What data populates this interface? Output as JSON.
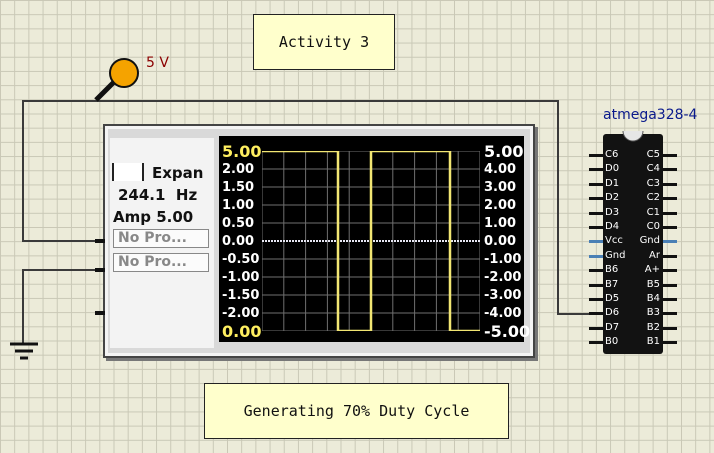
{
  "notes": {
    "activity": "Activity 3",
    "duty": "Generating 70% Duty Cycle"
  },
  "source": {
    "label": "5 V"
  },
  "oscilloscope": {
    "expand_label": "Expan",
    "frequency": "244.1  Hz",
    "amplitude": "Amp 5.00",
    "probe1": "No Pro...",
    "probe2": "No Pro...",
    "left_ticks": [
      "5.00",
      "2.00",
      "1.50",
      "1.00",
      "0.50",
      "0.00",
      "-0.50",
      "-1.00",
      "-1.50",
      "-2.00",
      "0.00"
    ],
    "right_ticks": [
      "5.00",
      "4.00",
      "3.00",
      "2.00",
      "1.00",
      "0.00",
      "-1.00",
      "-2.00",
      "-3.00",
      "-4.00",
      "-5.00"
    ],
    "trace_color": "#f2e673",
    "center_line_color": "#ffffff"
  },
  "chip": {
    "title": "atmega328-4",
    "left_pins": [
      "C6",
      "D0",
      "D1",
      "D2",
      "D3",
      "D4",
      "Vcc",
      "Gnd",
      "B6",
      "B7",
      "D5",
      "D6",
      "D7",
      "B0"
    ],
    "right_pins": [
      "C5",
      "C4",
      "C3",
      "C2",
      "C1",
      "C0",
      "Gnd",
      "Ar",
      "A+",
      "B5",
      "B4",
      "B3",
      "B2",
      "B1"
    ]
  }
}
